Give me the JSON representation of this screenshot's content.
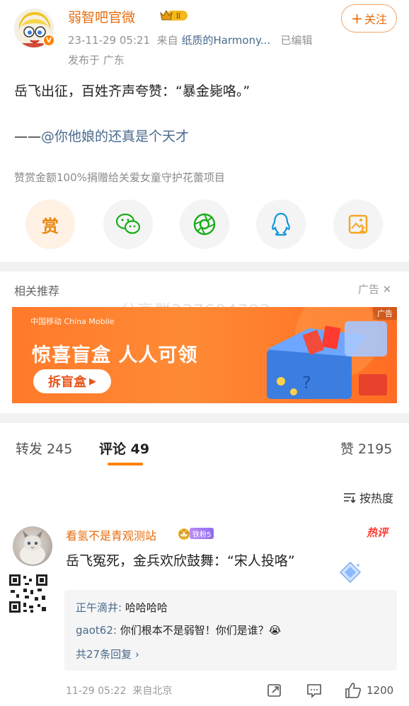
{
  "header": {
    "username": "弱智吧官微",
    "rank_badge": "Ⅱ",
    "time": "23-11-29 05:21",
    "from_prefix": "来自",
    "source": "纸质的Harmony...",
    "edited": "已编辑",
    "location": "发布于 广东",
    "follow_label": "关注"
  },
  "post": {
    "text": "岳飞出征，百姓齐声夸赞：“暴金毙咯。”",
    "mention_prefix": "——",
    "mention": "@你他娘的还真是个天才",
    "reward_note": "赞赏金额100%捐赠给关爱女童守护花蕾项目",
    "reward_button": "赏"
  },
  "share_icons": [
    "reward-icon",
    "wechat-icon",
    "moments-icon",
    "qq-icon",
    "save-image-icon"
  ],
  "related": {
    "title": "相关推荐",
    "ad_label": "广告",
    "watermark": "分享群237694793",
    "banner": {
      "brand": "中国移动 China Mobile",
      "title": "惊喜盲盒 人人可领",
      "cta": "拆盲盒",
      "tag": "广告"
    }
  },
  "tabs": [
    {
      "label": "转发 245"
    },
    {
      "label": "评论 49"
    },
    {
      "label": "赞 2195"
    }
  ],
  "sort_label": "按热度",
  "comment": {
    "name": "看氢不是青观测站",
    "fan_badge": "铁粉5",
    "hot": "热评",
    "text": "岳飞冤死，金兵欢欣鼓舞：“宋人投咯”",
    "replies": [
      {
        "user": "正午滴井:",
        "text": " 哈哈哈哈"
      },
      {
        "user": "gaot62:",
        "text": " 你们根本不是弱智！你们是谁？😭"
      }
    ],
    "more_replies": "共27条回复 ›",
    "time": "11-29 05:22",
    "location": "来自北京",
    "likes": "1200"
  },
  "colors": {
    "brand_orange": "#e86b0c",
    "link_blue": "#4a6a8c",
    "tab_underline": "#ff8200",
    "hot_red": "#ff3b30"
  }
}
